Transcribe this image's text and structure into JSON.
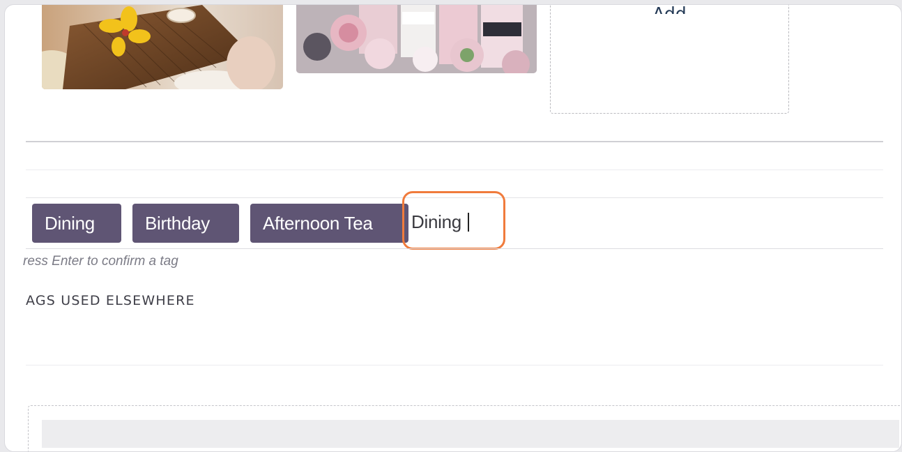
{
  "gallery": {
    "images": [
      {
        "name": "dining-photo",
        "alt": ""
      },
      {
        "name": "champagne-photo",
        "alt": ""
      }
    ],
    "add_button_label": "Add"
  },
  "tags": {
    "items": [
      {
        "label": "Dining"
      },
      {
        "label": "Birthday"
      },
      {
        "label": "Afternoon Tea"
      }
    ],
    "input_value": "Dining",
    "hint": "ress Enter to confirm a tag"
  },
  "elsewhere": {
    "title": "AGS USED ELSEWHERE"
  },
  "colors": {
    "tag_bg": "#5f5574",
    "focus_ring": "#f07b3c",
    "text_dark": "#243a56"
  }
}
